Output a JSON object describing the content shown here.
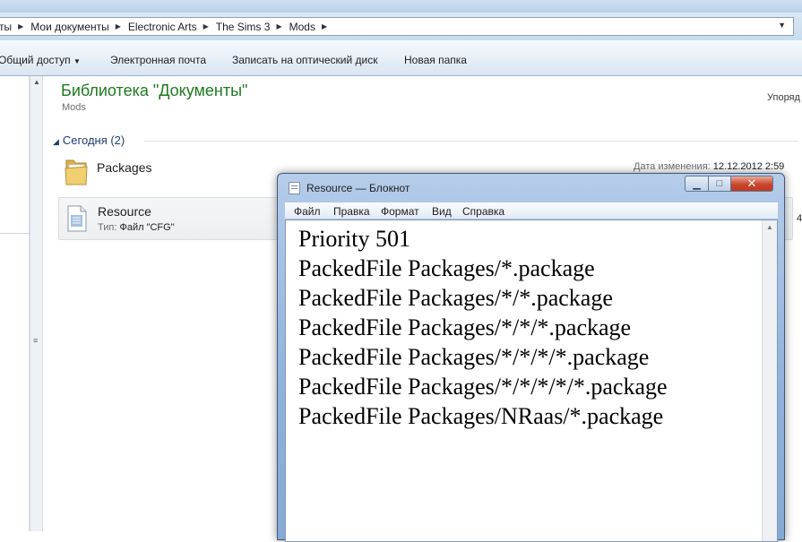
{
  "explorer": {
    "breadcrumb": [
      "ты",
      "Мои документы",
      "Electronic Arts",
      "The Sims 3",
      "Mods"
    ],
    "commands": {
      "share": "Общий доступ",
      "email": "Электронная почта",
      "burn": "Записать на оптический диск",
      "new_folder": "Новая папка"
    },
    "library_title": "Библиотека \"Документы\"",
    "library_subtitle": "Mods",
    "arrange_label": "Упоряд",
    "group_label": "Сегодня (2)",
    "files": [
      {
        "name": "Packages",
        "icon": "folder-icon",
        "date_label": "Дата изменения:",
        "date_value": "12.12.2012 2:59"
      },
      {
        "name": "Resource",
        "icon": "cfg-file-icon",
        "type_label": "Тип:",
        "type_value": "Файл \"CFG\"",
        "size_fragment": "4"
      }
    ]
  },
  "notepad": {
    "title": "Resource — Блокнот",
    "menu": [
      "Файл",
      "Правка",
      "Формат",
      "Вид",
      "Справка"
    ],
    "lines": [
      "Priority 501",
      "PackedFile Packages/*.package",
      "PackedFile Packages/*/*.package",
      "PackedFile Packages/*/*/*.package",
      "PackedFile Packages/*/*/*/*.package",
      "PackedFile Packages/*/*/*/*/*.package",
      "PackedFile Packages/NRaas/*.package"
    ]
  }
}
